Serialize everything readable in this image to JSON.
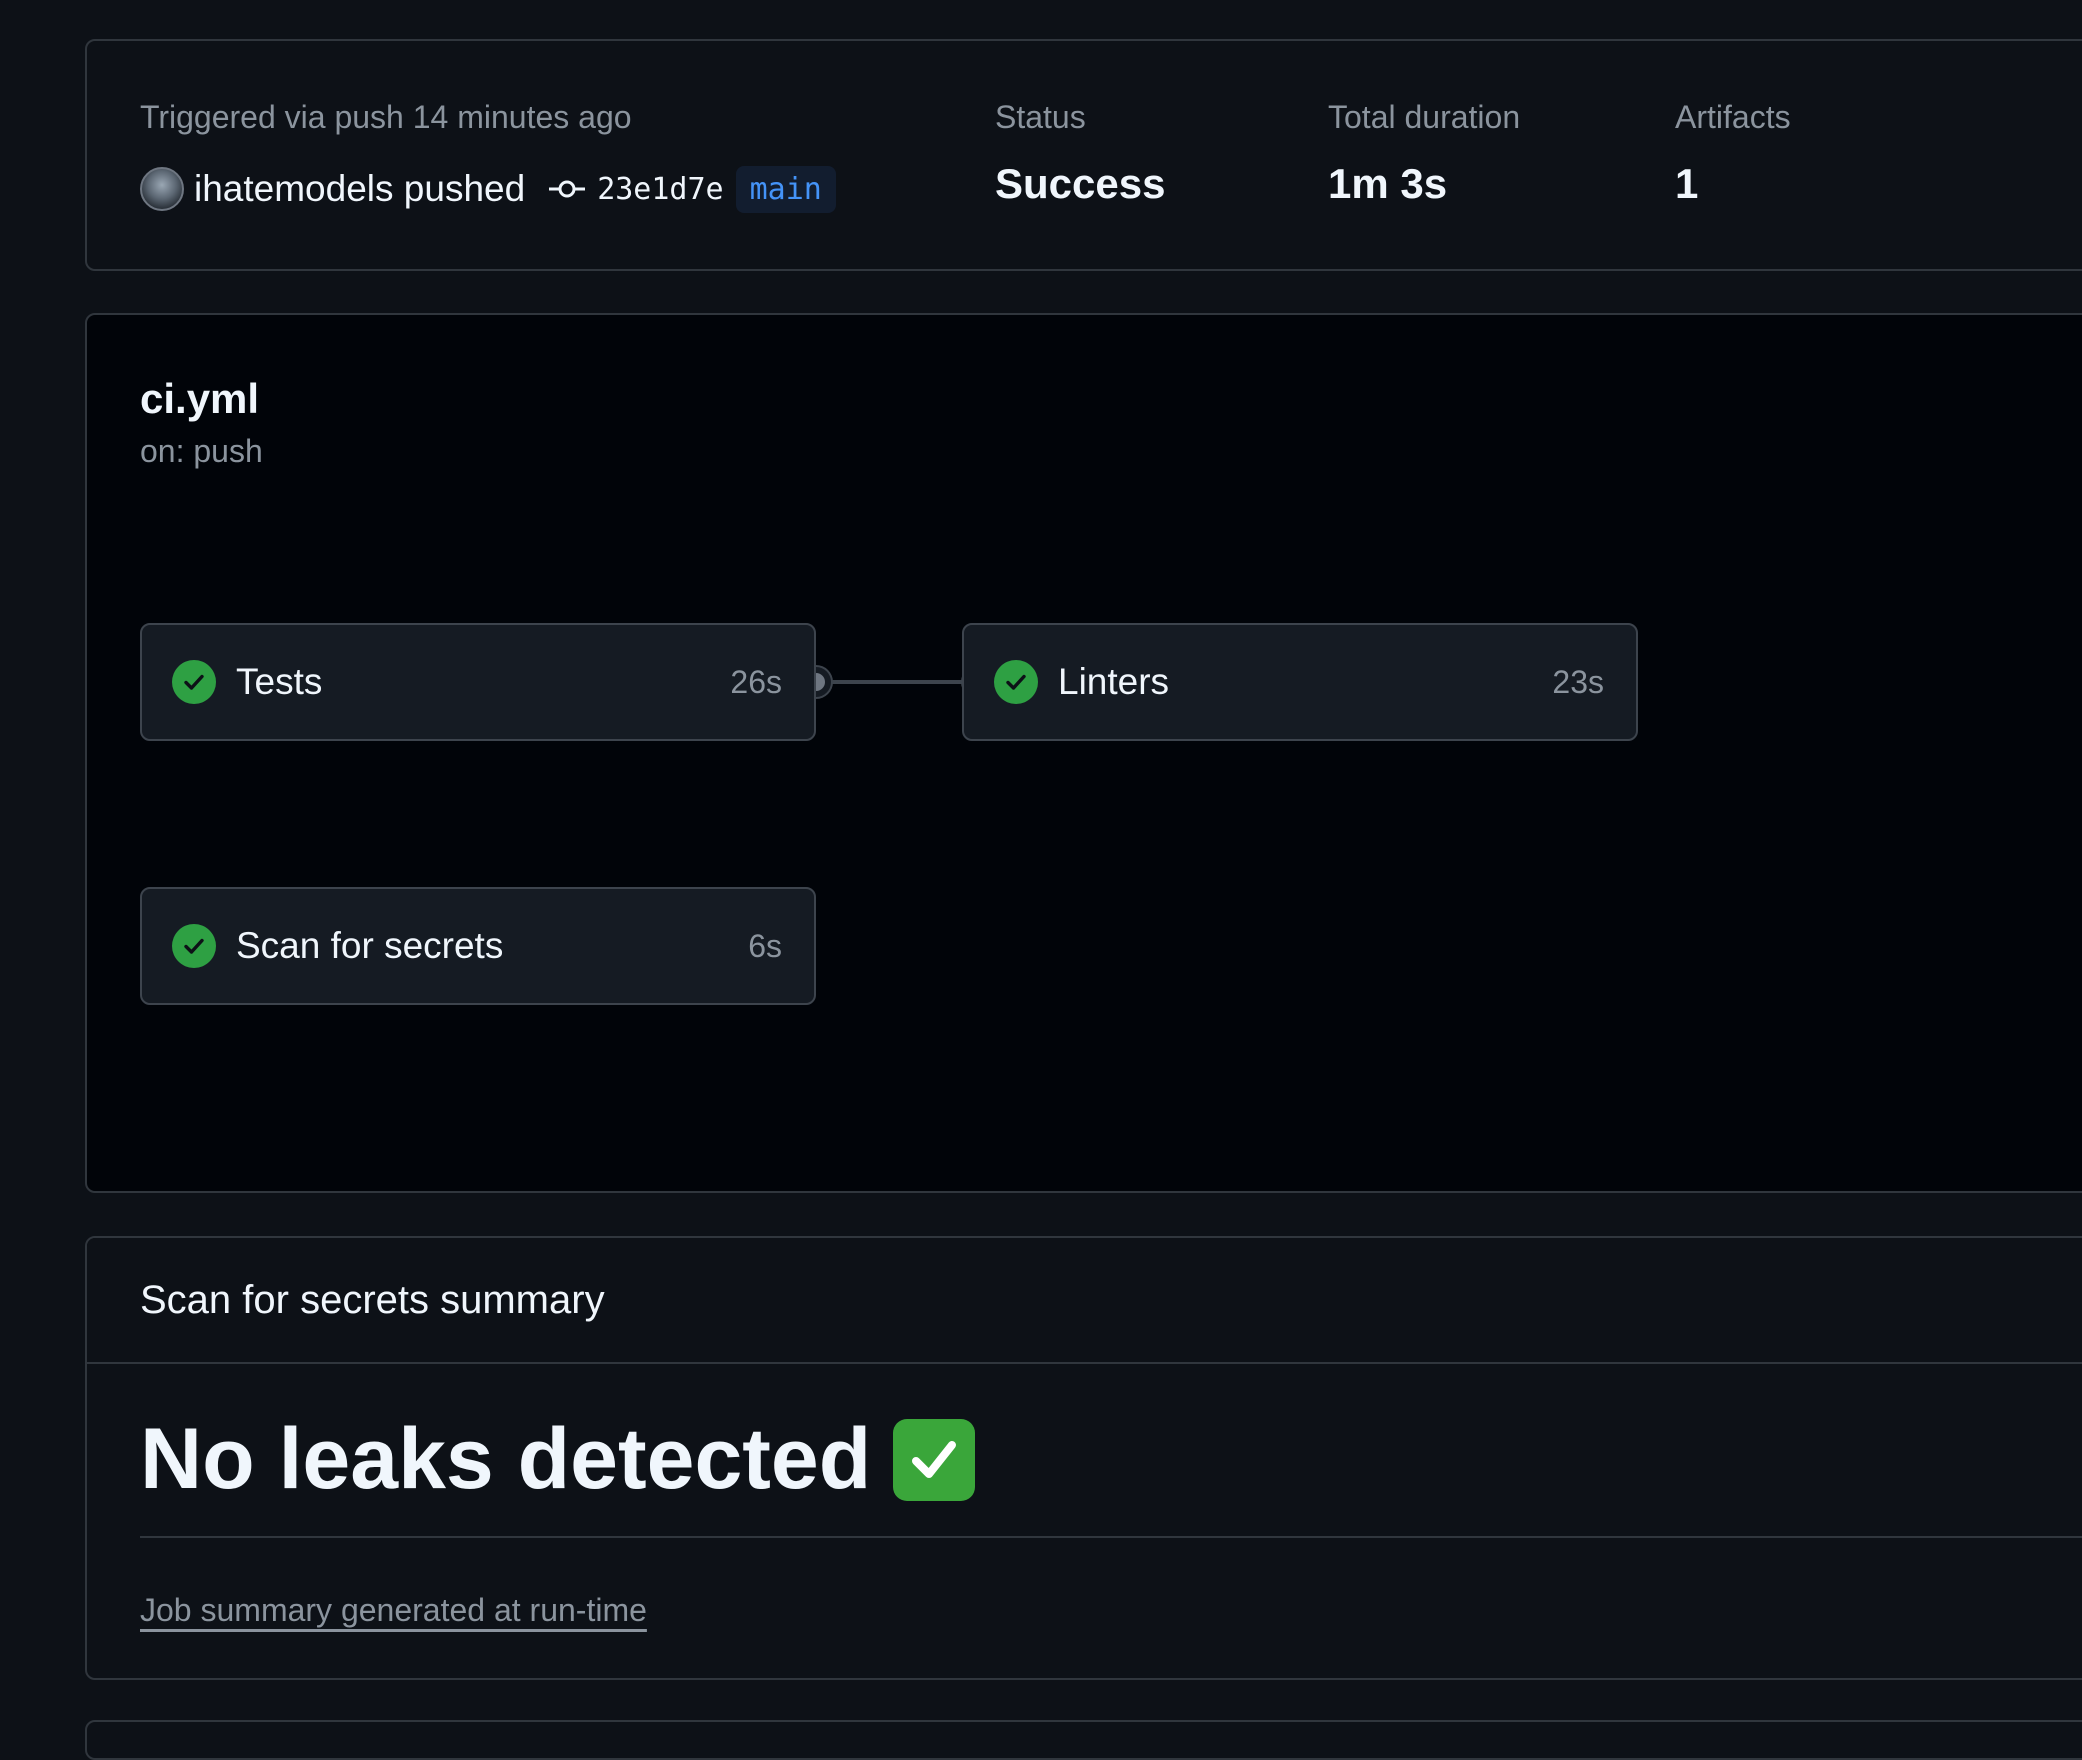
{
  "run_summary": {
    "trigger_text": "Triggered via push 14 minutes ago",
    "pusher_text": "ihatemodels pushed",
    "commit_sha": "23e1d7e",
    "branch": "main",
    "status_label": "Status",
    "status_value": "Success",
    "duration_label": "Total duration",
    "duration_value": "1m 3s",
    "artifacts_label": "Artifacts",
    "artifacts_value": "1"
  },
  "workflow": {
    "name": "ci.yml",
    "trigger": "on: push",
    "jobs": [
      {
        "name": "Tests",
        "duration": "26s",
        "status": "success",
        "icon": "check-circle-icon"
      },
      {
        "name": "Linters",
        "duration": "23s",
        "status": "success",
        "icon": "check-circle-icon"
      },
      {
        "name": "Scan for secrets",
        "duration": "6s",
        "status": "success",
        "icon": "check-circle-icon"
      }
    ]
  },
  "job_summary": {
    "title": "Scan for secrets summary",
    "heading": "No leaks detected",
    "heading_emoji": "white-heavy-check-mark-emoji",
    "footer_link": "Job summary generated at run-time"
  },
  "colors": {
    "background": "#0d1117",
    "graph_background": "#010409",
    "border": "#30363d",
    "success": "#2ea043",
    "branch_text": "#4493f8",
    "muted_text": "#8b949e"
  }
}
